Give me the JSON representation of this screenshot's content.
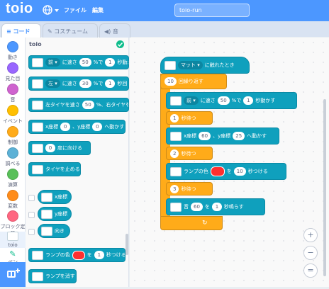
{
  "app": {
    "logo": "toio",
    "title": "toio-run"
  },
  "menu": {
    "file": "ファイル",
    "edit": "編集"
  },
  "tabs": [
    {
      "label": "コード"
    },
    {
      "label": "コスチューム"
    },
    {
      "label": "音"
    }
  ],
  "categories": [
    {
      "label": "動き",
      "color": "#4c97ff"
    },
    {
      "label": "見た目",
      "color": "#9966ff"
    },
    {
      "label": "音",
      "color": "#cf63cf"
    },
    {
      "label": "イベント",
      "color": "#ffbf00"
    },
    {
      "label": "制御",
      "color": "#ffab19"
    },
    {
      "label": "調べる",
      "color": "#5cb1d6"
    },
    {
      "label": "演算",
      "color": "#59c059"
    },
    {
      "label": "変数",
      "color": "#ff8c1a"
    },
    {
      "label": "ブロック定義",
      "color": "#ff6680"
    },
    {
      "label": "toio"
    },
    {
      "label": "ペン"
    }
  ],
  "palette": {
    "title": "toio",
    "blocks": [
      {
        "dir": "前",
        "t1": "に速さ",
        "speed": "50",
        "t2": "%で",
        "sec": "1",
        "t3": "秒動か"
      },
      {
        "dir": "左",
        "t1": "に速さ",
        "speed": "30",
        "t2": "%で",
        "sec": "1",
        "t3": "秒回"
      },
      {
        "left_text": "左タイヤを速さ",
        "left": "50",
        "t2": "%、右タイヤを速"
      },
      {
        "xlabel": "x座標",
        "x": "0",
        "ylabel": "、y座標",
        "y": "0",
        "tail": "へ動かす"
      },
      {
        "deg": "0",
        "tail": "度に向ける"
      },
      {
        "label": "タイヤを止める"
      },
      {
        "label": "x座標"
      },
      {
        "label": "y座標"
      },
      {
        "label": "向き"
      },
      {
        "pre": "ランプの色",
        "mid": "を",
        "sec": "1",
        "tail": "秒つける"
      },
      {
        "label": "ランプを消す"
      }
    ]
  },
  "script": {
    "hat": {
      "dd": "マット",
      "tail": "に触れたとき"
    },
    "repeat": {
      "n": "10",
      "label": "回繰り返す"
    },
    "move": {
      "dir": "前",
      "t1": "に速さ",
      "speed": "50",
      "t2": "%で",
      "sec": "1",
      "t3": "秒動かす"
    },
    "wait1": {
      "n": "1",
      "label": "秒待つ"
    },
    "goto": {
      "xlabel": "x座標",
      "x": "60",
      "ylabel": "、y座標",
      "y": "25",
      "tail": "へ動かす"
    },
    "wait2": {
      "n": "2",
      "label": "秒待つ"
    },
    "lamp": {
      "pre": "ランプの色",
      "mid": "を",
      "sec": "10",
      "tail": "秒つける"
    },
    "wait3": {
      "n": "3",
      "label": "秒待つ"
    },
    "sound": {
      "pre": "音",
      "note": "60",
      "mid": "を",
      "sec": "1",
      "tail": "秒鳴らす"
    }
  },
  "zoom": {
    "in": "+",
    "out": "−",
    "reset": "="
  }
}
